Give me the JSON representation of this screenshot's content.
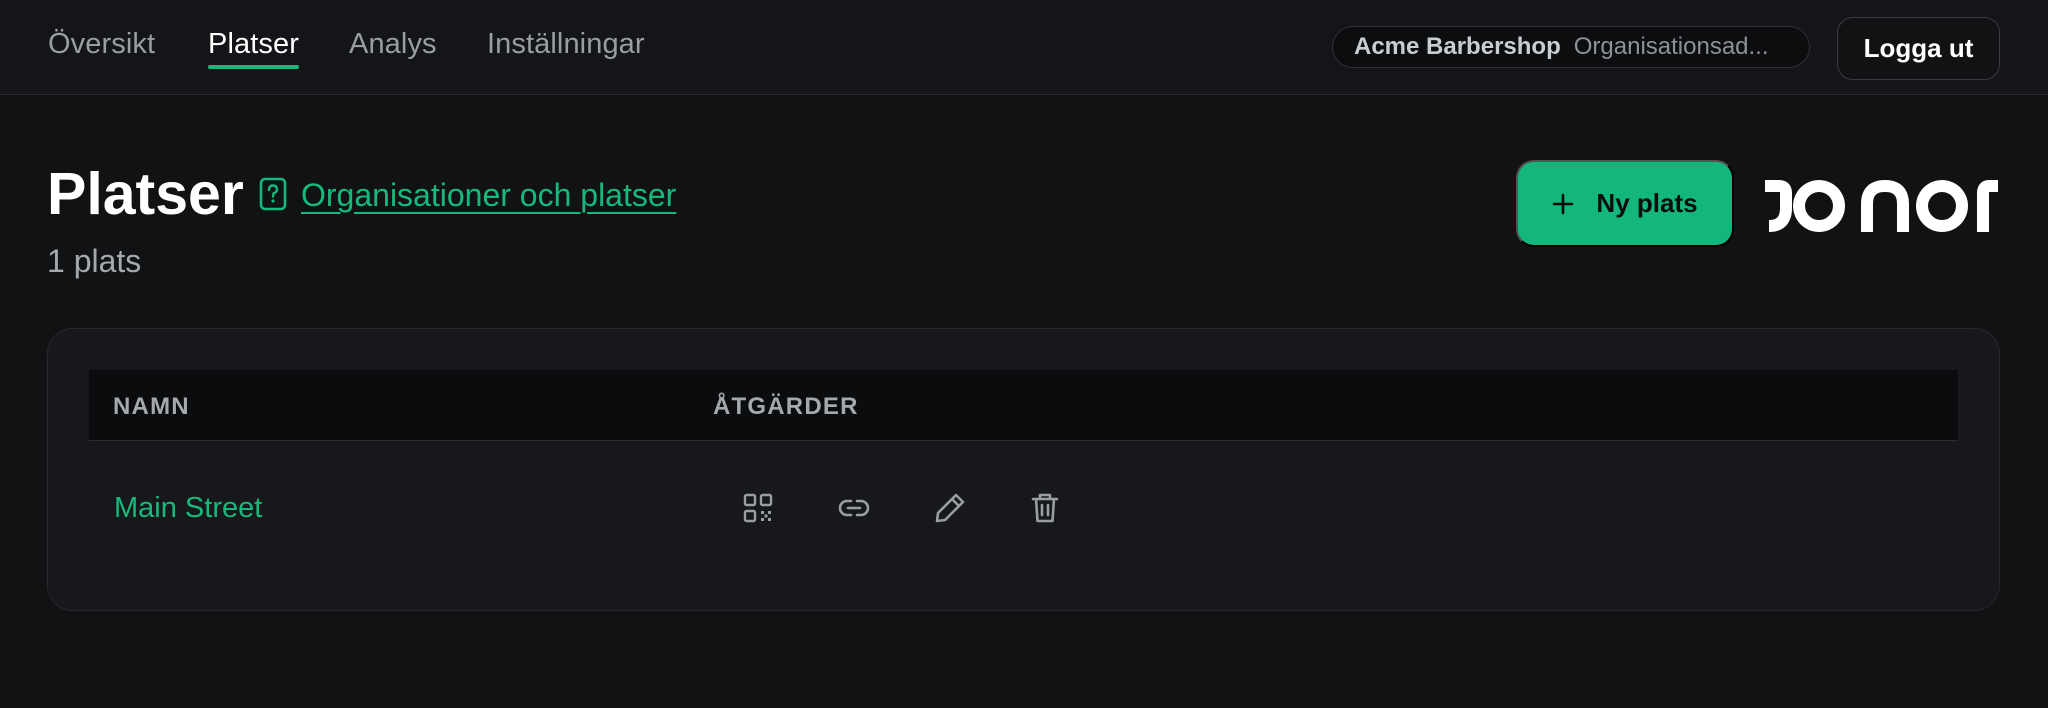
{
  "nav": {
    "tabs": [
      {
        "label": "Översikt"
      },
      {
        "label": "Platser"
      },
      {
        "label": "Analys"
      },
      {
        "label": "Inställningar"
      }
    ],
    "active_tab": "Platser"
  },
  "org": {
    "name": "Acme Barbershop",
    "address": "Organisationsad..."
  },
  "logout_label": "Logga ut",
  "page": {
    "title": "Platser",
    "doc_link": "Organisationer och platser",
    "count": "1 plats",
    "new_button": "Ny plats"
  },
  "table": {
    "columns": [
      "NAMN",
      "ÅTGÄRDER"
    ],
    "rows": [
      {
        "name": "Main Street",
        "actions": [
          "qr-code-icon",
          "link-icon",
          "pencil-icon",
          "trash-icon"
        ]
      }
    ]
  },
  "colors": {
    "accent": "#17b97b",
    "background": "#111214",
    "surface": "#17181b"
  }
}
